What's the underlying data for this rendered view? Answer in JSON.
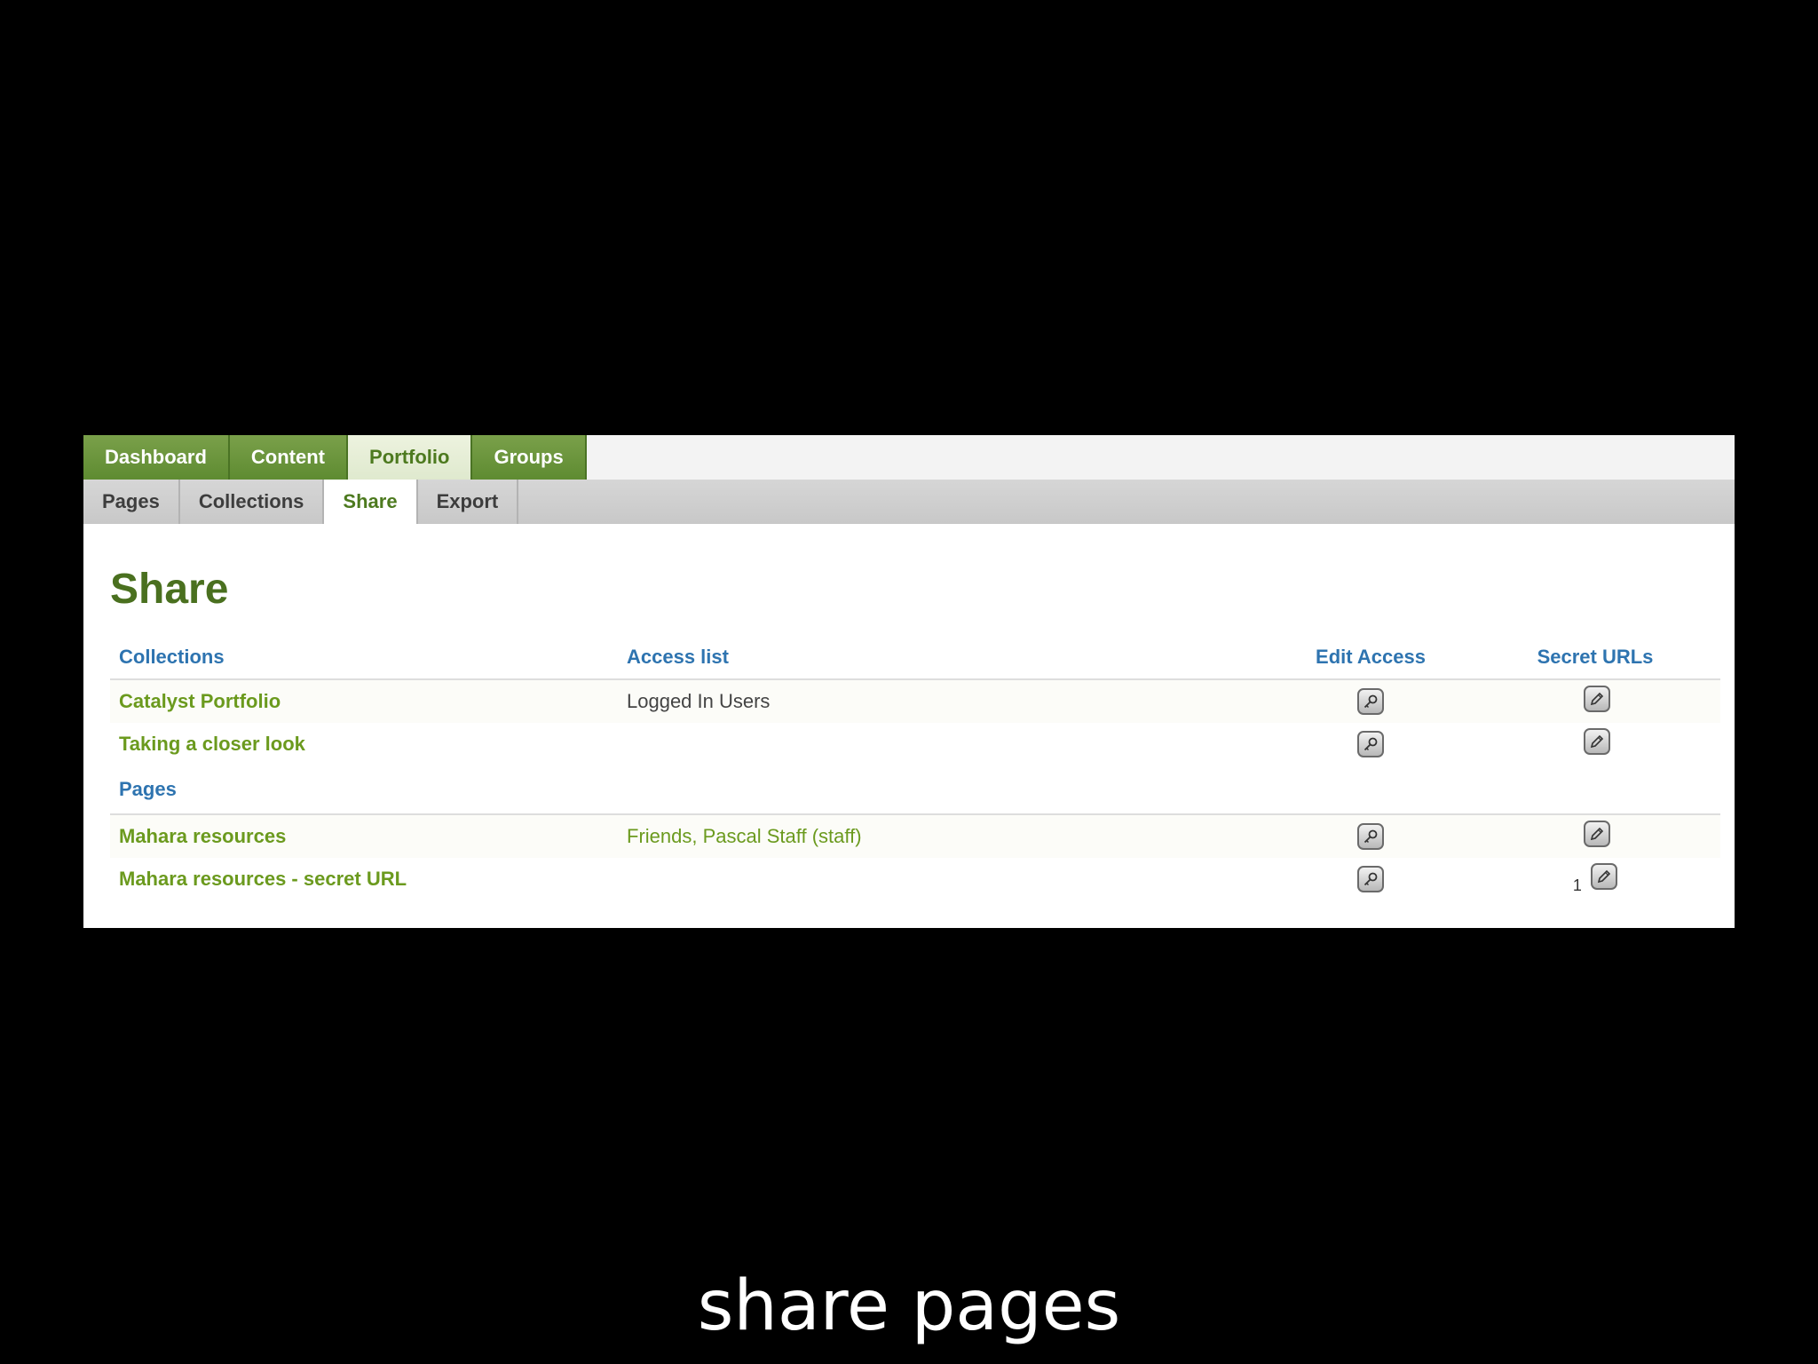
{
  "main_nav": {
    "tabs": [
      {
        "label": "Dashboard",
        "active": false
      },
      {
        "label": "Content",
        "active": false
      },
      {
        "label": "Portfolio",
        "active": true
      },
      {
        "label": "Groups",
        "active": false
      }
    ]
  },
  "sub_nav": {
    "tabs": [
      {
        "label": "Pages",
        "active": false
      },
      {
        "label": "Collections",
        "active": false
      },
      {
        "label": "Share",
        "active": true
      },
      {
        "label": "Export",
        "active": false
      }
    ]
  },
  "page": {
    "title": "Share"
  },
  "table": {
    "headers": {
      "collections": "Collections",
      "access_list": "Access list",
      "edit_access": "Edit Access",
      "secret_urls": "Secret URLs"
    },
    "collections": [
      {
        "name": "Catalyst Portfolio",
        "access": "Logged In Users",
        "secret_url_count": ""
      },
      {
        "name": "Taking a closer look",
        "access": "",
        "secret_url_count": ""
      }
    ],
    "pages_header": "Pages",
    "pages": [
      {
        "name": "Mahara resources",
        "access": "Friends, Pascal Staff (staff)",
        "secret_url_count": ""
      },
      {
        "name": "Mahara resources - secret URL",
        "access": "",
        "secret_url_count": "1"
      }
    ]
  },
  "icons": {
    "edit_access": "key-icon",
    "secret_urls": "pencil-icon"
  },
  "colors": {
    "nav_green": "#5e8b31",
    "link_green": "#6b9a1e",
    "title_green": "#4a701f",
    "header_blue": "#2e74b0"
  },
  "caption": "share pages"
}
